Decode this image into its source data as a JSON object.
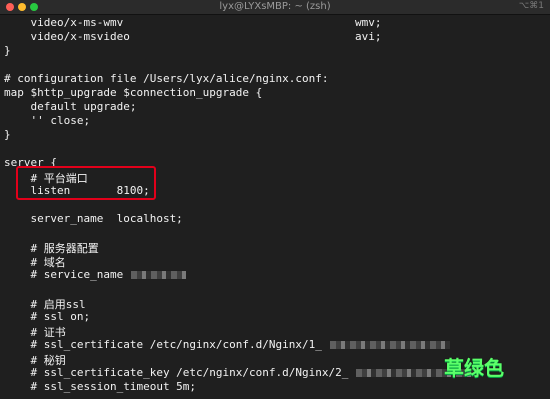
{
  "window": {
    "title": "lyx@LYXsMBP: ~ (zsh)",
    "shortcut": "⌥⌘1"
  },
  "code_lines": [
    "    video/x-ms-wmv                                   wmv;",
    "    video/x-msvideo                                  avi;",
    "}",
    "",
    "# configuration file /Users/lyx/alice/nginx.conf:",
    "map $http_upgrade $connection_upgrade {",
    "    default upgrade;",
    "    '' close;",
    "}",
    "",
    "server {",
    "    # 平台端口",
    "    listen       8100;",
    "",
    "    server_name  localhost;",
    "",
    "    # 服务器配置",
    "    # 域名",
    "    # service_name",
    "",
    "    # 启用ssl",
    "    # ssl on;",
    "    # 证书",
    "    # ssl_certificate /etc/nginx/conf.d/Nginx/1_",
    "    # 秘钥",
    "    # ssl_certificate_key /etc/nginx/conf.d/Nginx/2_",
    "    # ssl_session_timeout 5m;"
  ],
  "watermark": "草绿色"
}
